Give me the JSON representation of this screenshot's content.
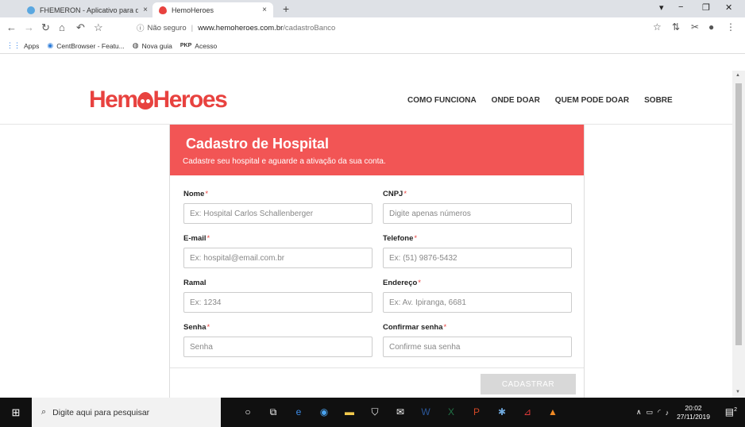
{
  "browser": {
    "tabs": [
      {
        "title": "FHEMERON - Aplicativo para do",
        "close": "×"
      },
      {
        "title": "HemoHeroes",
        "close": "×"
      }
    ],
    "new_tab": "+",
    "window_controls": {
      "dropdown": "▾",
      "minimize": "−",
      "maximize": "❐",
      "close": "✕"
    },
    "security_label": "Não seguro",
    "url_host": "www.hemoheroes.com.br",
    "url_path": "/cadastroBanco",
    "bookmarks": [
      {
        "label": "Apps",
        "icon": "apps-grid-icon"
      },
      {
        "label": "CentBrowser - Featu...",
        "icon": "centbrowser-icon"
      },
      {
        "label": "Nova guia",
        "icon": "globe-icon"
      },
      {
        "label": "Acesso",
        "icon": "pkp-icon",
        "prefix": "PKP"
      }
    ]
  },
  "site": {
    "logo_left": "Hem",
    "logo_right": "Heroes",
    "nav": [
      "COMO FUNCIONA",
      "ONDE DOAR",
      "QUEM PODE DOAR",
      "SOBRE"
    ]
  },
  "form": {
    "title": "Cadastro de Hospital",
    "subtitle": "Cadastre seu hospital e aguarde a ativação da sua conta.",
    "required_mark": "*",
    "fields": [
      {
        "label": "Nome",
        "required": true,
        "placeholder": "Ex: Hospital Carlos Schallenberger"
      },
      {
        "label": "CNPJ",
        "required": true,
        "placeholder": "Digite apenas números"
      },
      {
        "label": "E-mail",
        "required": true,
        "placeholder": "Ex: hospital@email.com.br"
      },
      {
        "label": "Telefone",
        "required": true,
        "placeholder": "Ex: (51) 9876-5432"
      },
      {
        "label": "Ramal",
        "required": false,
        "placeholder": "Ex: 1234"
      },
      {
        "label": "Endereço",
        "required": true,
        "placeholder": "Ex: Av. Ipiranga, 6681"
      },
      {
        "label": "Senha",
        "required": true,
        "placeholder": "Senha"
      },
      {
        "label": "Confirmar senha",
        "required": true,
        "placeholder": "Confirme sua senha"
      }
    ],
    "submit_label": "CADASTRAR"
  },
  "taskbar": {
    "search_placeholder": "Digite aqui para pesquisar",
    "time": "20:02",
    "date": "27/11/2019",
    "notifications": "2"
  },
  "colors": {
    "brand": "#e8423f",
    "header_bg": "#f25555",
    "button_disabled": "#d8d8d8"
  }
}
